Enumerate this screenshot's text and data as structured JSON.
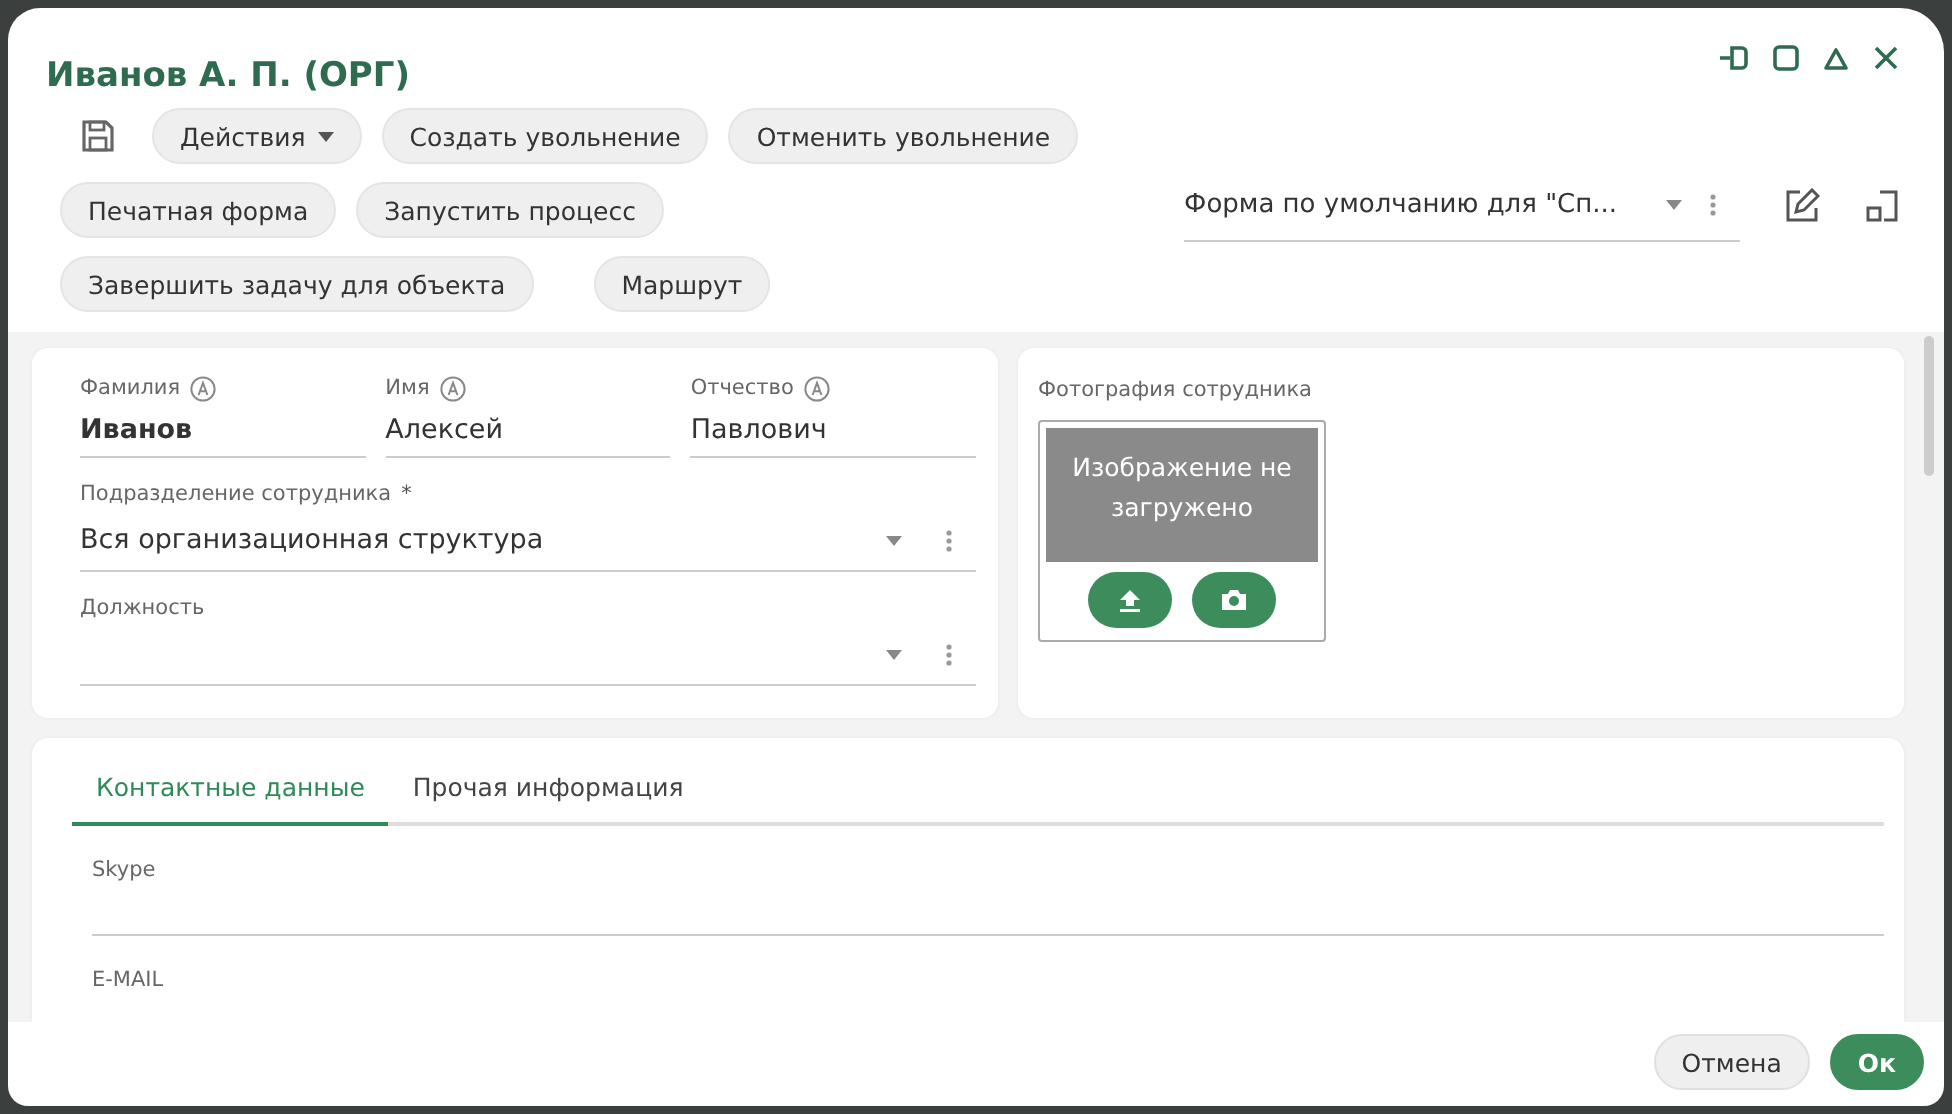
{
  "window": {
    "title": "Иванов А. П. (ОРГ)"
  },
  "toolbar": {
    "buttons": [
      {
        "label": "Действия",
        "kind": "menu"
      },
      {
        "label": "Создать увольнение",
        "kind": "plain"
      },
      {
        "label": "Отменить увольнение",
        "kind": "plain"
      },
      {
        "label": "Печатная форма",
        "kind": "plain"
      },
      {
        "label": "Запустить процесс",
        "kind": "plain"
      },
      {
        "label": "Завершить задачу для объекта",
        "kind": "plain"
      },
      {
        "label": "Маршрут",
        "kind": "plain"
      }
    ]
  },
  "form_selector": {
    "value": "Форма по умолчанию для \"Сп..."
  },
  "name_fields": [
    {
      "label": "Фамилия",
      "value": "Иванов",
      "bold": true
    },
    {
      "label": "Имя",
      "value": "Алексей",
      "bold": false
    },
    {
      "label": "Отчество",
      "value": "Павлович",
      "bold": false
    }
  ],
  "select_fields": [
    {
      "label": "Подразделение сотрудника",
      "required_mark": "*",
      "value": "Вся организационная структура"
    },
    {
      "label": "Должность"
    }
  ],
  "photo": {
    "label": "Фотография сотрудника",
    "placeholder_text": "Изображение не загружено"
  },
  "tabs": [
    {
      "label": "Контактные данные",
      "selected": true
    },
    {
      "label": "Прочая информация",
      "selected": false
    }
  ],
  "contact_fields": [
    {
      "label": "Skype"
    },
    {
      "label": "E-MAIL"
    }
  ],
  "footer": {
    "buttons": [
      {
        "label": "Отмена",
        "kind": "secondary"
      },
      {
        "label": "Ок",
        "kind": "primary"
      }
    ]
  }
}
